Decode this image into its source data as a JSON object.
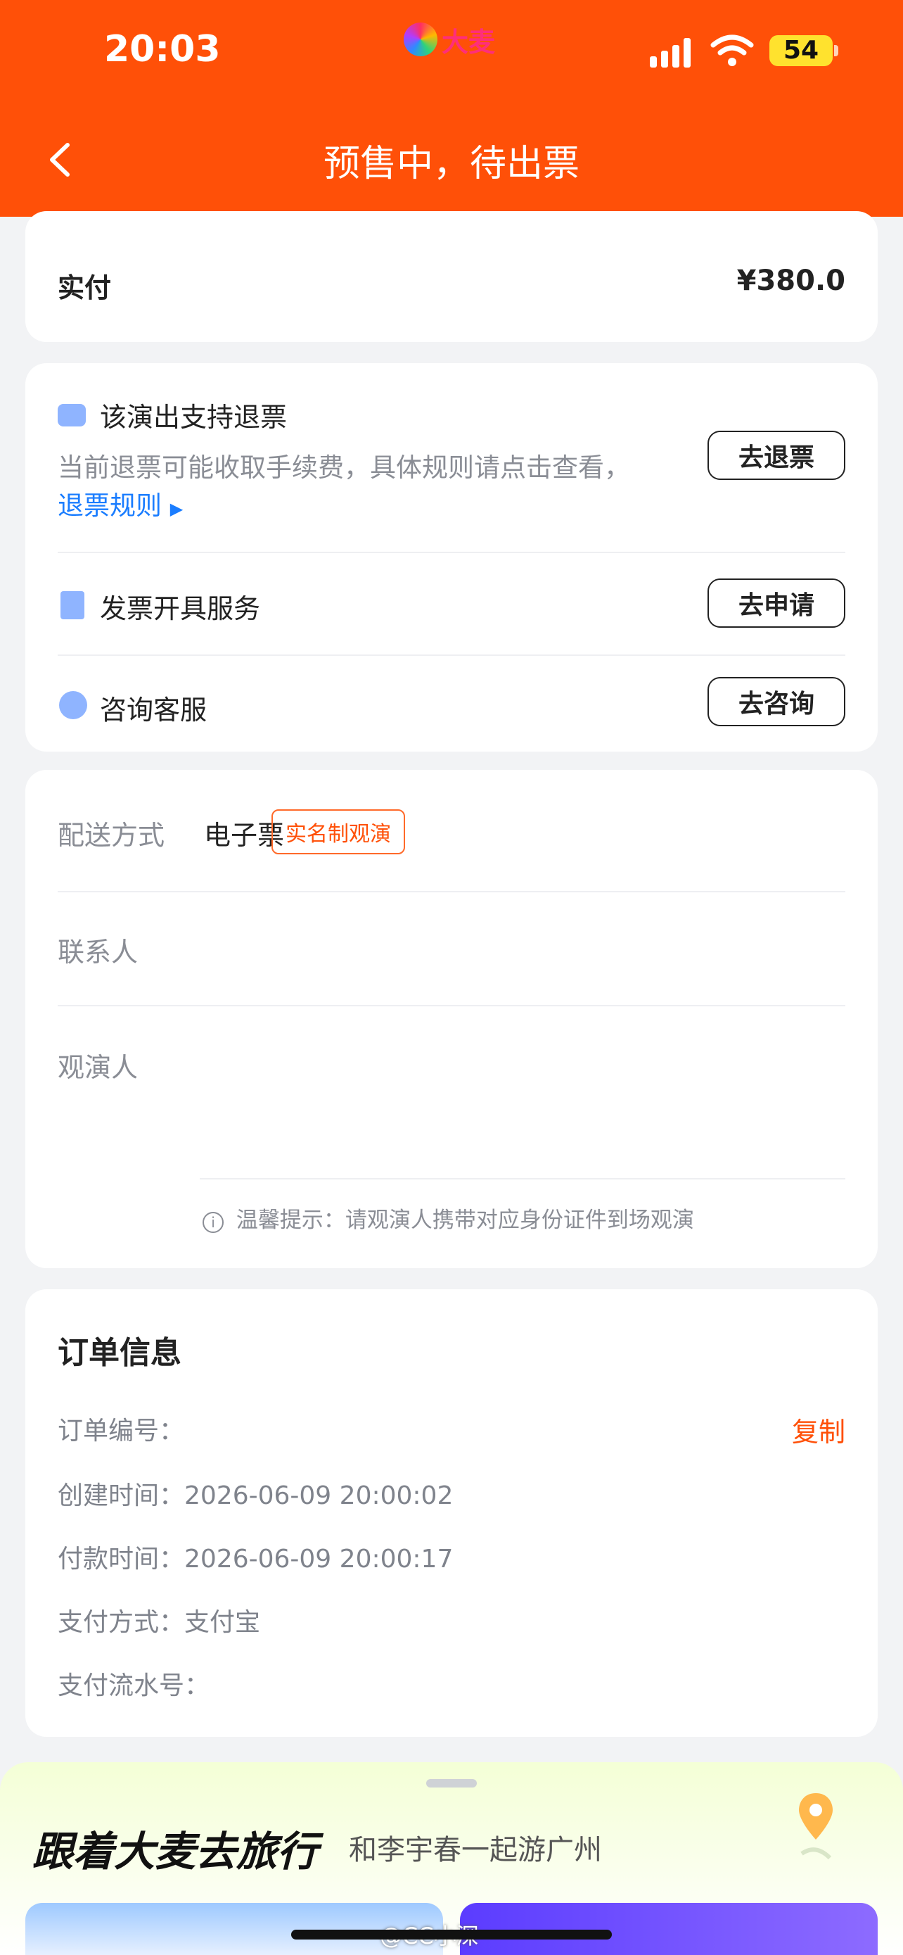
{
  "status_bar": {
    "time": "20:03",
    "app_name": "大麦",
    "battery": "54"
  },
  "nav": {
    "title": "预售中，待出票",
    "back_icon": "chevron-left-icon"
  },
  "payment": {
    "label": "实付",
    "amount": "¥380.0"
  },
  "services": {
    "refund": {
      "title": "该演出支持退票",
      "desc": "当前退票可能收取手续费，具体规则请点击查看，",
      "rules_link": "退票规则",
      "button": "去退票",
      "icon": "ticket-icon"
    },
    "invoice": {
      "title": "发票开具服务",
      "button": "去申请",
      "icon": "receipt-icon"
    },
    "consult": {
      "title": "咨询客服",
      "button": "去咨询",
      "icon": "chat-icon"
    }
  },
  "delivery": {
    "method_label": "配送方式",
    "method_value": "电子票",
    "tag": "实名制观演",
    "contact_label": "联系人",
    "viewer_label": "观演人",
    "tip": "温馨提示：请观演人携带对应身份证件到场观演"
  },
  "order": {
    "title": "订单信息",
    "number_label": "订单编号：",
    "copy": "复制",
    "created": "创建时间：2026-06-09 20:00:02",
    "paid": "付款时间：2026-06-09 20:00:17",
    "method": "支付方式：支付宝",
    "serial_label": "支付流水号："
  },
  "promo": {
    "title": "跟着大麦去旅行",
    "subtitle": "和李宇春一起游广州"
  },
  "watermark": "@CC小深",
  "colors": {
    "brand": "#ff5008",
    "link": "#1a7dff"
  }
}
